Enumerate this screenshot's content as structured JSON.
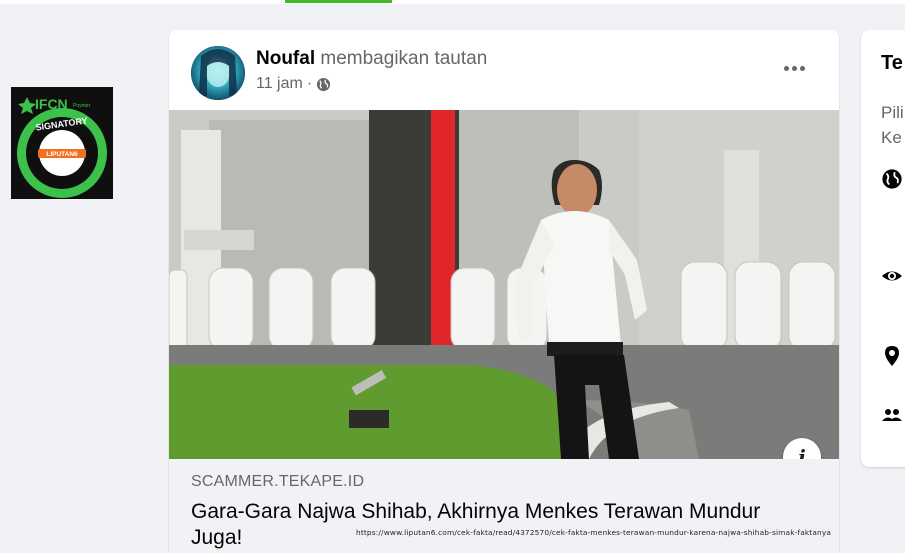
{
  "post": {
    "author": "Noufal",
    "action": "membagikan tautan",
    "time": "11 jam",
    "separator": "·",
    "link_domain": "SCAMMER.TEKAPE.ID",
    "link_title": "Gara-Gara Najwa Shihab, Akhirnya Menkes Terawan Mundur Juga!"
  },
  "badge": {
    "org": "IFCN",
    "org_small": "Poynter",
    "ring_text": "SIGNATORY",
    "center_text": "LIPUTAN6"
  },
  "side_panel": {
    "title": "Te",
    "desc_line1": "Pili",
    "desc_line2": "Ke"
  },
  "source_url": "https://www.liputan6.com/cek-fakta/read/4372570/cek-fakta-menkes-terawan-mundur-karena-najwa-shihab-simak-faktanya",
  "colors": {
    "accent_green": "#42b72a",
    "badge_green": "#3cc14a",
    "text_secondary": "#65676b"
  },
  "icons": {
    "globe": "globe-icon",
    "eye": "eye-icon",
    "location": "location-pin-icon",
    "group": "group-icon",
    "more": "more-options-icon",
    "info": "info-icon"
  }
}
